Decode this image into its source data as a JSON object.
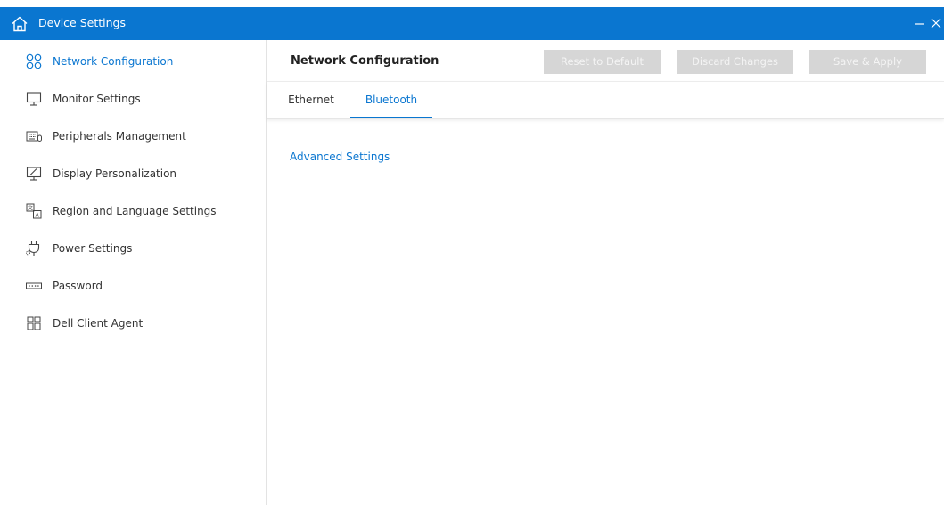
{
  "app": {
    "title": "Device Settings",
    "home_icon": "home-icon",
    "minimize_glyph": "–",
    "close_glyph": "✕",
    "accent_color": "#0a76d0"
  },
  "sidebar": {
    "items": [
      {
        "label": "Network Configuration",
        "icon": "network-icon",
        "active": true
      },
      {
        "label": "Monitor Settings",
        "icon": "monitor-icon",
        "active": false
      },
      {
        "label": "Peripherals Management",
        "icon": "keyboard-icon",
        "active": false
      },
      {
        "label": "Display Personalization",
        "icon": "display-personalization-icon",
        "active": false
      },
      {
        "label": "Region and Language Settings",
        "icon": "language-icon",
        "active": false
      },
      {
        "label": "Power Settings",
        "icon": "power-plug-icon",
        "active": false
      },
      {
        "label": "Password",
        "icon": "password-icon",
        "active": false
      },
      {
        "label": "Dell Client Agent",
        "icon": "agent-grid-icon",
        "active": false
      }
    ]
  },
  "main": {
    "title": "Network Configuration",
    "buttons": {
      "reset": "Reset to Default",
      "discard": "Discard Changes",
      "save": "Save & Apply"
    },
    "tabs": [
      {
        "label": "Ethernet",
        "active": false
      },
      {
        "label": "Bluetooth",
        "active": true
      }
    ],
    "advanced_link": "Advanced Settings"
  }
}
